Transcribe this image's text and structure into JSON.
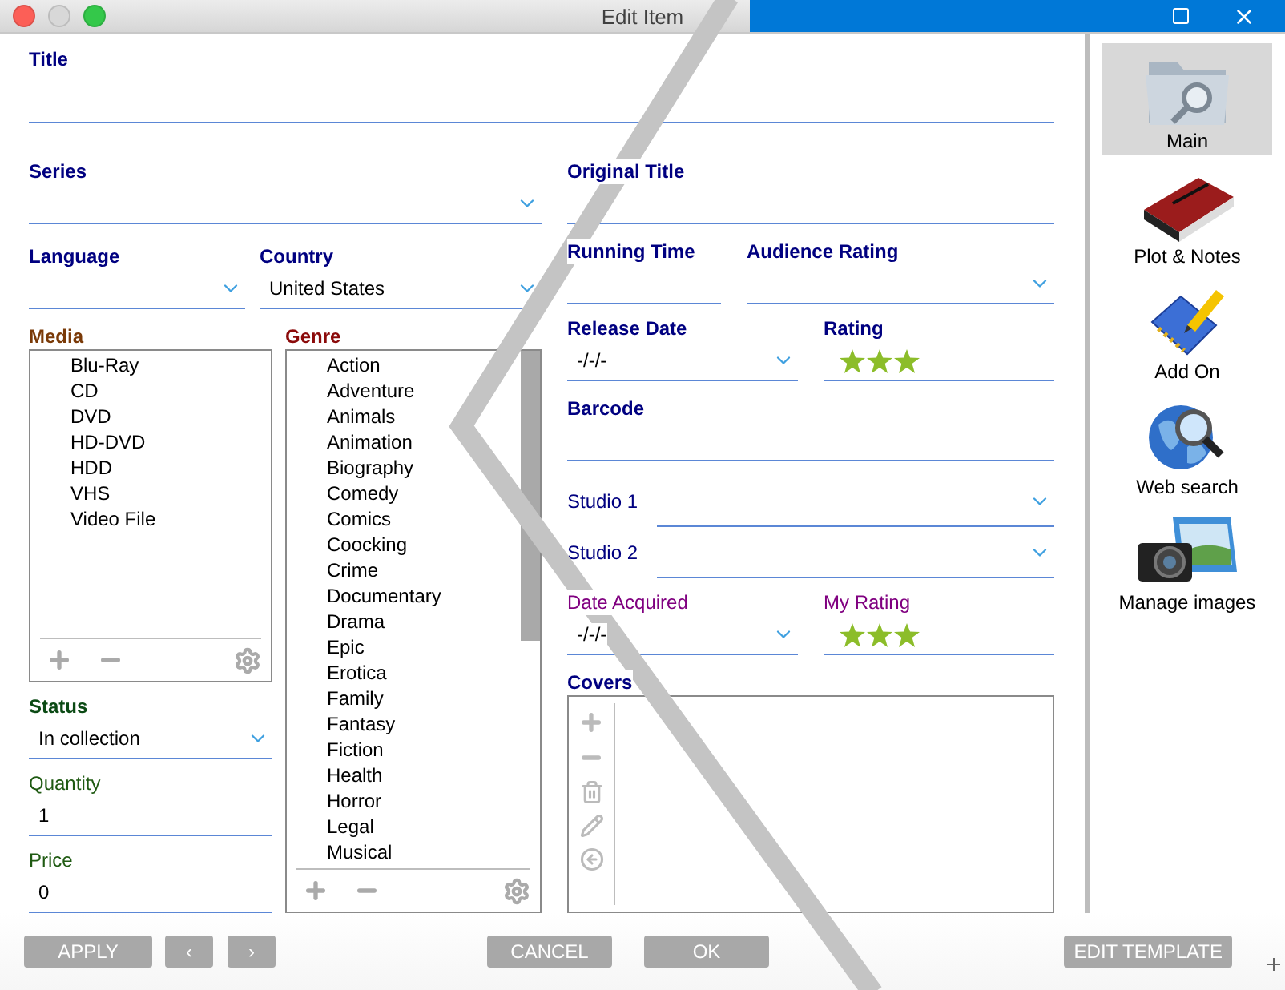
{
  "window": {
    "title": "Edit Item"
  },
  "form": {
    "title": {
      "label": "Title"
    },
    "series": {
      "label": "Series"
    },
    "language": {
      "label": "Language"
    },
    "country": {
      "label": "Country",
      "value": "United States"
    },
    "media": {
      "label": "Media",
      "items": [
        "Blu-Ray",
        "CD",
        "DVD",
        "HD-DVD",
        "HDD",
        "VHS",
        "Video File"
      ]
    },
    "genre": {
      "label": "Genre",
      "items": [
        "Action",
        "Adventure",
        "Animals",
        "Animation",
        "Biography",
        "Comedy",
        "Comics",
        "Coocking",
        "Crime",
        "Documentary",
        "Drama",
        "Epic",
        "Erotica",
        "Family",
        "Fantasy",
        "Fiction",
        "Health",
        "Horror",
        "Legal",
        "Musical"
      ]
    },
    "status": {
      "label": "Status",
      "value": "In collection"
    },
    "quantity": {
      "label": "Quantity",
      "value": "1"
    },
    "price": {
      "label": "Price",
      "value": "0"
    },
    "original_title": {
      "label": "Original Title"
    },
    "running_time": {
      "label": "Running Time"
    },
    "audience_rating": {
      "label": "Audience Rating"
    },
    "release_date": {
      "label": "Release Date",
      "value": "-/-/-"
    },
    "rating": {
      "label": "Rating",
      "stars": 3
    },
    "barcode": {
      "label": "Barcode"
    },
    "studio_1": {
      "label": "Studio 1"
    },
    "studio_2": {
      "label": "Studio 2"
    },
    "date_acquired": {
      "label": "Date Acquired",
      "value": "-/-/-"
    },
    "my_rating": {
      "label": "My Rating",
      "stars": 3
    },
    "covers": {
      "label": "Covers"
    }
  },
  "sidebar": {
    "items": [
      {
        "label": "Main",
        "selected": true
      },
      {
        "label": "Plot & Notes",
        "selected": false
      },
      {
        "label": "Add On",
        "selected": false
      },
      {
        "label": "Web search",
        "selected": false
      },
      {
        "label": "Manage images",
        "selected": false
      }
    ]
  },
  "buttons": {
    "apply": "APPLY",
    "previous": "‹",
    "next": "›",
    "cancel": "CANCEL",
    "ok": "OK",
    "edit_template": "EDIT TEMPLATE"
  }
}
